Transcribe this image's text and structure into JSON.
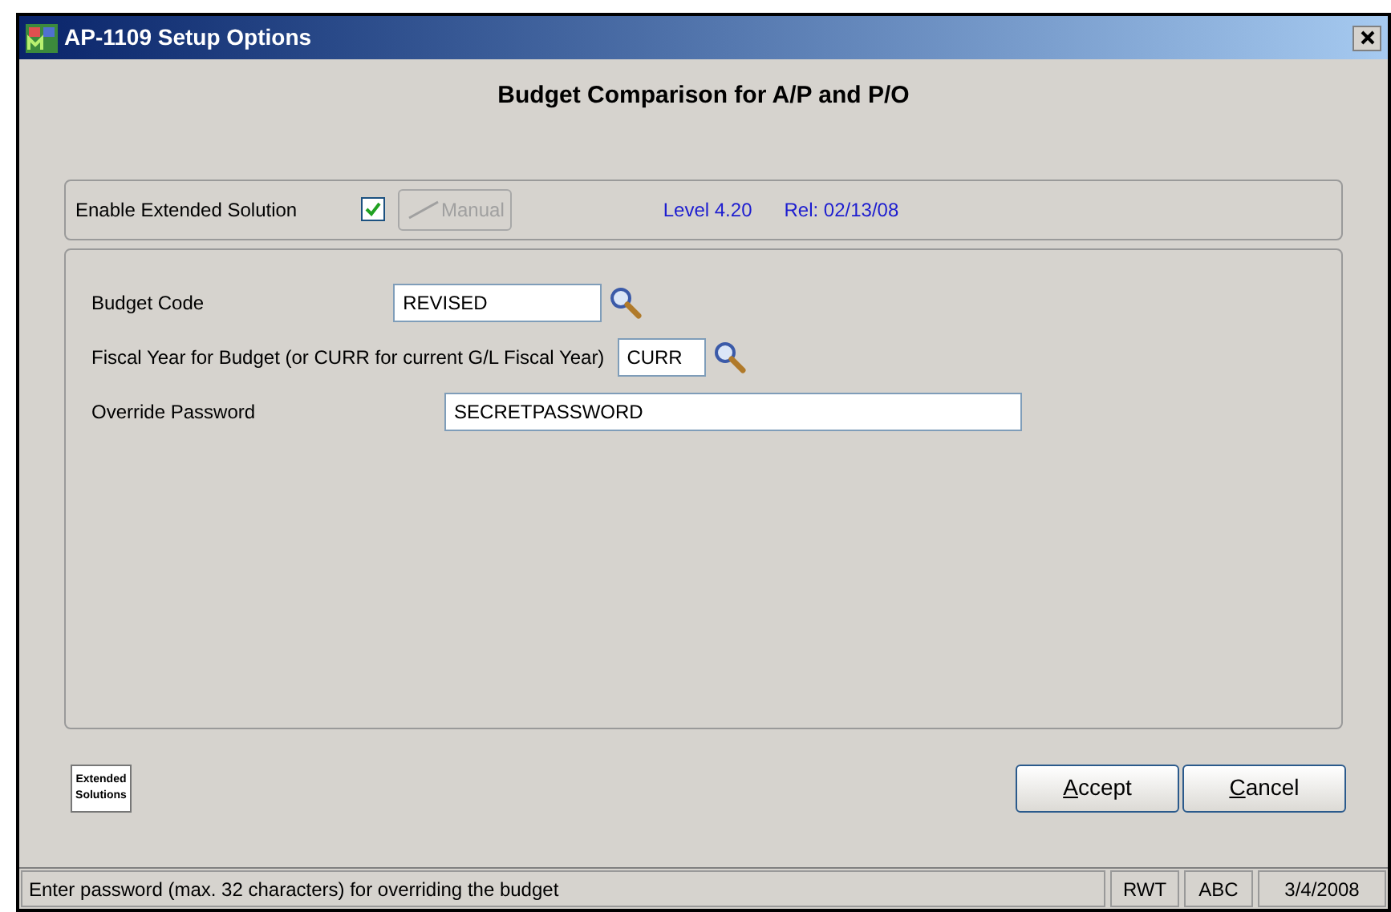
{
  "window": {
    "title": "AP-1109 Setup Options"
  },
  "heading": "Budget Comparison for A/P and P/O",
  "enable": {
    "label": "Enable Extended Solution",
    "checked": true,
    "manual_button": {
      "label": "Manual",
      "disabled": true
    },
    "level": "Level 4.20",
    "release": "Rel: 02/13/08"
  },
  "fields": [
    {
      "label": "Budget Code",
      "value": "REVISED",
      "lookup": true
    },
    {
      "label": "Fiscal Year for Budget  (or CURR for current G/L Fiscal Year)",
      "value": "CURR",
      "lookup": true
    },
    {
      "label": "Override Password",
      "value": "SECRETPASSWORD",
      "lookup": false
    }
  ],
  "logo": {
    "line_1": "Extended",
    "line_2": "Solutions"
  },
  "buttons": [
    {
      "label": "Accept"
    },
    {
      "label": "Cancel"
    }
  ],
  "status_bar": {
    "message": "Enter password (max. 32 characters) for overriding the budget",
    "user": "RWT",
    "company": "ABC",
    "date": "3/4/2008"
  }
}
